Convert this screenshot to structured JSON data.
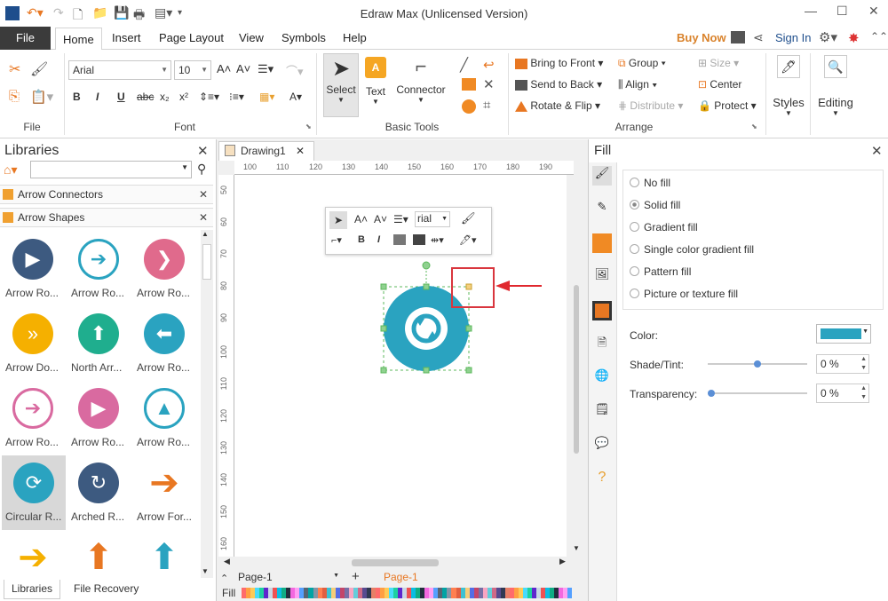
{
  "window": {
    "title": "Edraw Max (Unlicensed Version)"
  },
  "menu": {
    "file": "File",
    "tabs": [
      "Home",
      "Insert",
      "Page Layout",
      "View",
      "Symbols",
      "Help"
    ],
    "buy_now": "Buy Now",
    "sign_in": "Sign In"
  },
  "ribbon": {
    "file_group": "File",
    "font_group": "Font",
    "font_name": "Arial",
    "font_size": "10",
    "basic_tools_group": "Basic Tools",
    "select": "Select",
    "text": "Text",
    "connector": "Connector",
    "arrange_group": "Arrange",
    "bring_front": "Bring to Front",
    "send_back": "Send to Back",
    "rotate_flip": "Rotate & Flip",
    "group": "Group",
    "align": "Align",
    "distribute": "Distribute",
    "size": "Size",
    "center": "Center",
    "protect": "Protect",
    "styles": "Styles",
    "editing": "Editing"
  },
  "libraries": {
    "title": "Libraries",
    "sections": [
      "Arrow Connectors",
      "Arrow Shapes"
    ],
    "shapes": [
      {
        "label": "Arrow Ro...",
        "color": "#3d5a80",
        "glyph": "▶",
        "fg": "#fff",
        "style": "fill"
      },
      {
        "label": "Arrow Ro...",
        "color": "#2aa3c0",
        "glyph": "➔",
        "fg": "#2aa3c0",
        "style": "ring"
      },
      {
        "label": "Arrow Ro...",
        "color": "#e06a8c",
        "glyph": "❯",
        "fg": "#fff",
        "style": "fill"
      },
      {
        "label": "Arrow Do...",
        "color": "#f5b000",
        "glyph": "»",
        "fg": "#fff",
        "style": "fill"
      },
      {
        "label": "North Arr...",
        "color": "#1fae8e",
        "glyph": "⬆",
        "fg": "#fff",
        "style": "fill"
      },
      {
        "label": "Arrow Ro...",
        "color": "#2aa3c0",
        "glyph": "⬅",
        "fg": "#fff",
        "style": "fill"
      },
      {
        "label": "Arrow Ro...",
        "color": "#d96aa0",
        "glyph": "➔",
        "fg": "#d96aa0",
        "style": "ring"
      },
      {
        "label": "Arrow Ro...",
        "color": "#d96aa0",
        "glyph": "▶",
        "fg": "#fff",
        "style": "fill"
      },
      {
        "label": "Arrow Ro...",
        "color": "#2aa3c0",
        "glyph": "▲",
        "fg": "#2aa3c0",
        "style": "ring"
      },
      {
        "label": "Circular R...",
        "color": "#2aa3c0",
        "glyph": "⟳",
        "fg": "#fff",
        "style": "fill"
      },
      {
        "label": "Arched R...",
        "color": "#3d5a80",
        "glyph": "↻",
        "fg": "#fff",
        "style": "fill"
      },
      {
        "label": "Arrow For...",
        "color": "#e87722",
        "glyph": "➔",
        "fg": "#e87722",
        "style": "plain"
      },
      {
        "label": "",
        "color": "#f5b000",
        "glyph": "➔",
        "fg": "#f5b000",
        "style": "plain"
      },
      {
        "label": "",
        "color": "#e87722",
        "glyph": "⬆",
        "fg": "#e87722",
        "style": "plain"
      },
      {
        "label": "",
        "color": "#2aa3c0",
        "glyph": "⬆",
        "fg": "#2aa3c0",
        "style": "plain"
      }
    ],
    "bottom_tabs": [
      "Libraries",
      "File Recovery"
    ]
  },
  "document": {
    "tab": "Drawing1",
    "ruler_h": [
      "100",
      "110",
      "120",
      "130",
      "140",
      "150",
      "160",
      "170",
      "180",
      "190"
    ],
    "ruler_v": [
      "50",
      "60",
      "70",
      "80",
      "90",
      "100",
      "110",
      "120",
      "130",
      "140",
      "150",
      "160"
    ],
    "page_selector": "Page-1",
    "page_tab": "Page-1",
    "fill_label": "Fill",
    "mini_font": "rial"
  },
  "fill": {
    "title": "Fill",
    "options": [
      "No fill",
      "Solid fill",
      "Gradient fill",
      "Single color gradient fill",
      "Pattern fill",
      "Picture or texture fill"
    ],
    "selected": "Solid fill",
    "color_label": "Color:",
    "color_value": "#2aa3c0",
    "shade_label": "Shade/Tint:",
    "shade_value": "0 %",
    "transparency_label": "Transparency:",
    "transparency_value": "0 %"
  },
  "colors": {
    "accent": "#2aa3c0",
    "palette": [
      "#ff6b6b",
      "#ff9f43",
      "#feca57",
      "#48dbfb",
      "#1dd1a1",
      "#5f27cd",
      "#c8d6e5",
      "#ee5253",
      "#0abde3",
      "#10ac84",
      "#222f3e",
      "#f368e0",
      "#ff9ff3",
      "#54a0ff",
      "#576574",
      "#01a3a4",
      "#8395a7",
      "#ff7f50",
      "#e15f41",
      "#3dc1d3",
      "#f5cd79",
      "#546de5",
      "#c44569",
      "#786fa6",
      "#f8a5c2",
      "#63cdda",
      "#cf6a87",
      "#574b90",
      "#303952",
      "#e77f67"
    ]
  }
}
